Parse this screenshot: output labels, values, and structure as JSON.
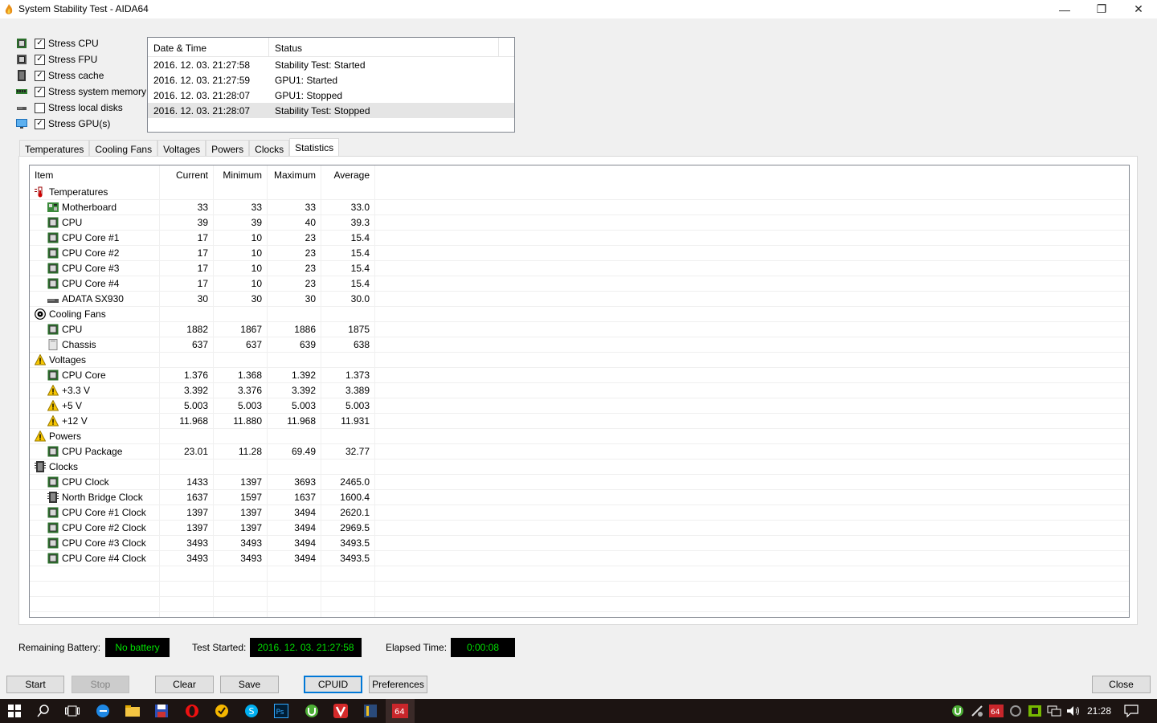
{
  "window": {
    "title": "System Stability Test - AIDA64",
    "minimize": "—",
    "maximize": "❐",
    "close": "✕"
  },
  "stress_options": [
    {
      "label": "Stress CPU",
      "checked": true,
      "icon": "cpu-chip-icon"
    },
    {
      "label": "Stress FPU",
      "checked": true,
      "icon": "fpu-chip-icon"
    },
    {
      "label": "Stress cache",
      "checked": true,
      "icon": "cache-chip-icon"
    },
    {
      "label": "Stress system memory",
      "checked": true,
      "icon": "memory-module-icon"
    },
    {
      "label": "Stress local disks",
      "checked": false,
      "icon": "disk-drive-icon"
    },
    {
      "label": "Stress GPU(s)",
      "checked": true,
      "icon": "monitor-icon"
    }
  ],
  "log": {
    "headers": {
      "datetime": "Date & Time",
      "status": "Status"
    },
    "rows": [
      {
        "datetime": "2016. 12. 03. 21:27:58",
        "status": "Stability Test: Started"
      },
      {
        "datetime": "2016. 12. 03. 21:27:59",
        "status": "GPU1: Started"
      },
      {
        "datetime": "2016. 12. 03. 21:28:07",
        "status": "GPU1: Stopped"
      },
      {
        "datetime": "2016. 12. 03. 21:28:07",
        "status": "Stability Test: Stopped"
      }
    ]
  },
  "tabs": [
    "Temperatures",
    "Cooling Fans",
    "Voltages",
    "Powers",
    "Clocks",
    "Statistics"
  ],
  "active_tab": "Statistics",
  "stats": {
    "headers": {
      "item": "Item",
      "current": "Current",
      "minimum": "Minimum",
      "maximum": "Maximum",
      "average": "Average"
    },
    "rows": [
      {
        "group": true,
        "icon": "thermometer-icon",
        "item": "Temperatures"
      },
      {
        "icon": "motherboard-icon",
        "item": "Motherboard",
        "current": "33",
        "minimum": "33",
        "maximum": "33",
        "average": "33.0"
      },
      {
        "icon": "cpu-chip-icon",
        "item": "CPU",
        "current": "39",
        "minimum": "39",
        "maximum": "40",
        "average": "39.3"
      },
      {
        "icon": "cpu-chip-icon",
        "item": "CPU Core #1",
        "current": "17",
        "minimum": "10",
        "maximum": "23",
        "average": "15.4"
      },
      {
        "icon": "cpu-chip-icon",
        "item": "CPU Core #2",
        "current": "17",
        "minimum": "10",
        "maximum": "23",
        "average": "15.4"
      },
      {
        "icon": "cpu-chip-icon",
        "item": "CPU Core #3",
        "current": "17",
        "minimum": "10",
        "maximum": "23",
        "average": "15.4"
      },
      {
        "icon": "cpu-chip-icon",
        "item": "CPU Core #4",
        "current": "17",
        "minimum": "10",
        "maximum": "23",
        "average": "15.4"
      },
      {
        "icon": "disk-drive-icon",
        "item": "ADATA SX930",
        "current": "30",
        "minimum": "30",
        "maximum": "30",
        "average": "30.0"
      },
      {
        "group": true,
        "icon": "fan-icon",
        "item": "Cooling Fans"
      },
      {
        "icon": "cpu-chip-icon",
        "item": "CPU",
        "current": "1882",
        "minimum": "1867",
        "maximum": "1886",
        "average": "1875"
      },
      {
        "icon": "chassis-icon",
        "item": "Chassis",
        "current": "637",
        "minimum": "637",
        "maximum": "639",
        "average": "638"
      },
      {
        "group": true,
        "icon": "warning-icon",
        "item": "Voltages"
      },
      {
        "icon": "cpu-chip-icon",
        "item": "CPU Core",
        "current": "1.376",
        "minimum": "1.368",
        "maximum": "1.392",
        "average": "1.373"
      },
      {
        "icon": "warning-icon",
        "item": "+3.3 V",
        "current": "3.392",
        "minimum": "3.376",
        "maximum": "3.392",
        "average": "3.389"
      },
      {
        "icon": "warning-icon",
        "item": "+5 V",
        "current": "5.003",
        "minimum": "5.003",
        "maximum": "5.003",
        "average": "5.003"
      },
      {
        "icon": "warning-icon",
        "item": "+12 V",
        "current": "11.968",
        "minimum": "11.880",
        "maximum": "11.968",
        "average": "11.931"
      },
      {
        "group": true,
        "icon": "warning-icon",
        "item": "Powers"
      },
      {
        "icon": "cpu-chip-icon",
        "item": "CPU Package",
        "current": "23.01",
        "minimum": "11.28",
        "maximum": "69.49",
        "average": "32.77"
      },
      {
        "group": true,
        "icon": "clock-chip-icon",
        "item": "Clocks"
      },
      {
        "icon": "cpu-chip-icon",
        "item": "CPU Clock",
        "current": "1433",
        "minimum": "1397",
        "maximum": "3693",
        "average": "2465.0"
      },
      {
        "icon": "clock-chip-icon",
        "item": "North Bridge Clock",
        "current": "1637",
        "minimum": "1597",
        "maximum": "1637",
        "average": "1600.4"
      },
      {
        "icon": "cpu-chip-icon",
        "item": "CPU Core #1 Clock",
        "current": "1397",
        "minimum": "1397",
        "maximum": "3494",
        "average": "2620.1"
      },
      {
        "icon": "cpu-chip-icon",
        "item": "CPU Core #2 Clock",
        "current": "1397",
        "minimum": "1397",
        "maximum": "3494",
        "average": "2969.5"
      },
      {
        "icon": "cpu-chip-icon",
        "item": "CPU Core #3 Clock",
        "current": "3493",
        "minimum": "3493",
        "maximum": "3494",
        "average": "3493.5"
      },
      {
        "icon": "cpu-chip-icon",
        "item": "CPU Core #4 Clock",
        "current": "3493",
        "minimum": "3493",
        "maximum": "3494",
        "average": "3493.5"
      }
    ]
  },
  "footer": {
    "battery_label": "Remaining Battery:",
    "battery_value": "No battery",
    "started_label": "Test Started:",
    "started_value": "2016. 12. 03. 21:27:58",
    "elapsed_label": "Elapsed Time:",
    "elapsed_value": "0:00:08"
  },
  "buttons": {
    "start": "Start",
    "stop": "Stop",
    "clear": "Clear",
    "save": "Save",
    "cpuid": "CPUID",
    "preferences": "Preferences",
    "close": "Close"
  },
  "taskbar": {
    "clock": "21:28",
    "items": [
      "windows-start-icon",
      "search-icon",
      "task-view-icon",
      "edge-browser-icon",
      "file-explorer-icon",
      "floppy-app-icon",
      "opera-icon",
      "norton-icon",
      "skype-icon",
      "photoshop-icon",
      "utorrent-icon",
      "vivaldi-icon",
      "app-icon",
      "aida64-icon"
    ],
    "tray": [
      "utorrent-tray-icon",
      "network-tool-icon",
      "aida64-tray-icon",
      "steelseries-icon",
      "nvidia-icon",
      "network-icon",
      "volume-icon",
      "notifications-icon"
    ]
  },
  "colors": {
    "accent": "#0078d7",
    "display_bg": "#000000",
    "display_fg": "#00e000"
  }
}
